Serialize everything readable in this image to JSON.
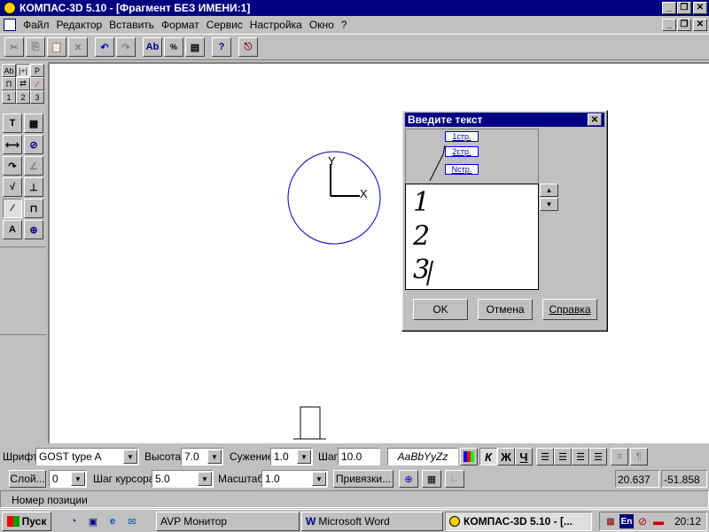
{
  "window": {
    "title": "КОМПАС-3D 5.10 - [Фрагмент БЕЗ ИМЕНИ:1]"
  },
  "menu": {
    "items": [
      "Файл",
      "Редактор",
      "Вставить",
      "Формат",
      "Сервис",
      "Настройка",
      "Окно",
      "?"
    ]
  },
  "left_panel": {
    "small_buttons": [
      "Аb",
      "|+|",
      "Р",
      "П",
      "⇄",
      "∕",
      "1",
      "2",
      "3"
    ]
  },
  "canvas": {
    "axis_y_label": "Y",
    "axis_x_label": "X"
  },
  "dialog": {
    "title": "Введите текст",
    "preview_items": [
      "1стр.",
      "2стр.",
      "Nстр."
    ],
    "text_lines": [
      "1",
      "2",
      "3"
    ],
    "ok_label": "OK",
    "cancel_label": "Отмена",
    "help_label": "Справка"
  },
  "format_bar": {
    "font_label": "Шрифт",
    "font_value": "GOST type A",
    "height_label": "Высота",
    "height_value": "7.0",
    "narrow_label": "Сужение",
    "narrow_value": "1.0",
    "step_label": "Шаг",
    "step_value": "10.0",
    "sample_text": "AaBbYyZz",
    "italic_label": "К",
    "bold_label": "Ж",
    "underline_label": "Ч"
  },
  "bottom_bar": {
    "layer_button": "Слой...",
    "layer_value": "0",
    "cursor_step_label": "Шаг курсора",
    "cursor_step_value": "5.0",
    "scale_label": "Масштаб",
    "scale_value": "1.0",
    "snap_button": "Привязки...",
    "coord_x": "20.637",
    "coord_y": "-51.858"
  },
  "status": {
    "text": "Номер позиции"
  },
  "taskbar": {
    "start_label": "Пуск",
    "tasks": [
      "AVP Монитор",
      "Microsoft Word",
      "КОМПАС-3D 5.10 - [..."
    ],
    "lang": "En",
    "clock": "20:12"
  },
  "colors": {
    "title_bar": "#000080",
    "circle": "#0000c0",
    "face": "#c0c0c0",
    "preview_box": "#0000ff"
  }
}
